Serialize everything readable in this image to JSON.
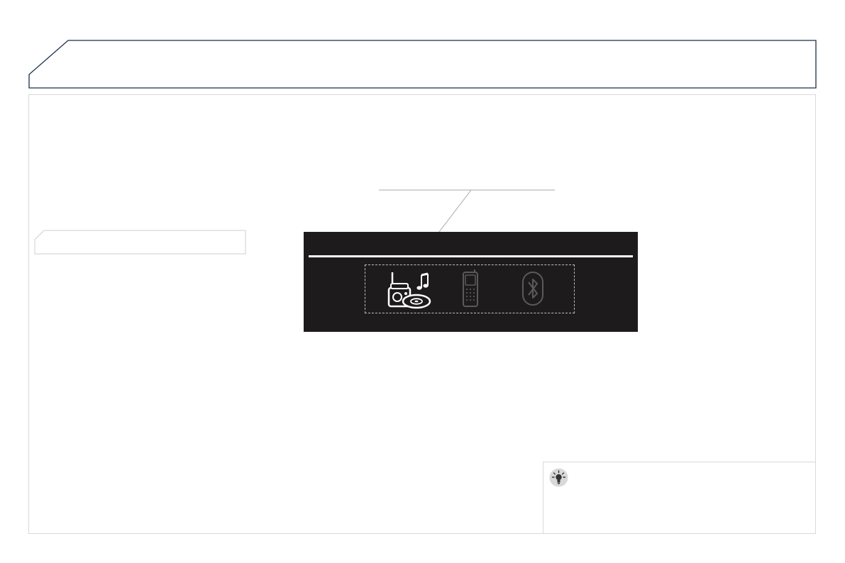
{
  "page": {
    "header_tab": {
      "title": ""
    },
    "section_tab": {
      "label": ""
    },
    "screen": {
      "highlighted": "audio-sources",
      "icons": [
        "radio-cd-music-icon",
        "mobile-phone-icon",
        "bluetooth-icon"
      ]
    },
    "tip_box": {
      "icon": "light-bulb-tip-icon",
      "text": ""
    }
  },
  "colors": {
    "header_outline": "#1b2f4a",
    "screen_background": "#1e1b1d",
    "frame_border": "#d9d9d9",
    "dimmed_icon": "#5a5a5a"
  }
}
